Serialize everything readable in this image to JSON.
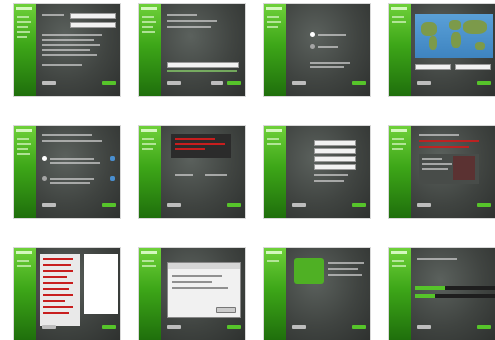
{
  "installer": {
    "screens": [
      {
        "id": "welcome"
      },
      {
        "id": "keyboard"
      },
      {
        "id": "partitions"
      },
      {
        "id": "timezone"
      },
      {
        "id": "install-type"
      },
      {
        "id": "disk-warning"
      },
      {
        "id": "user-setup"
      },
      {
        "id": "summary"
      },
      {
        "id": "partition-tool"
      },
      {
        "id": "dialog"
      },
      {
        "id": "packages"
      },
      {
        "id": "progress"
      }
    ]
  },
  "palette": {
    "sidebar_top": "#6fd13a",
    "sidebar_bottom": "#1f6f0c",
    "content": "#404441",
    "accent_red": "#c81e1e"
  }
}
